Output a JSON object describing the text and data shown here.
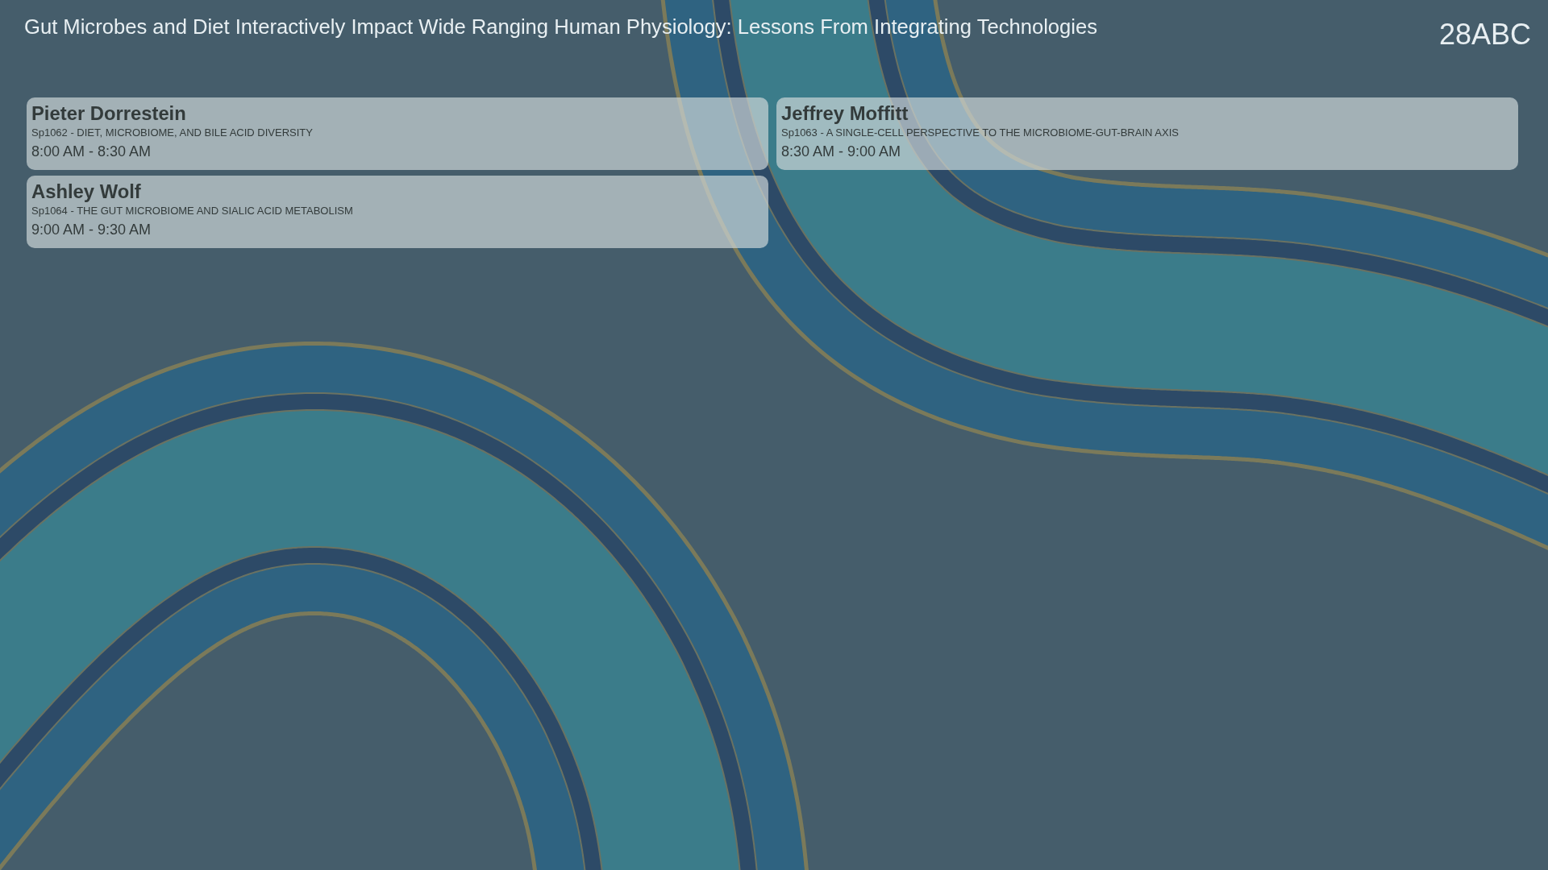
{
  "header": {
    "title": "Gut Microbes and Diet Interactively Impact Wide Ranging Human Physiology: Lessons From Integrating Technologies",
    "room": "28ABC"
  },
  "sessions": [
    {
      "speaker": "Pieter Dorrestein",
      "title": "Sp1062 - DIET, MICROBIOME, AND BILE ACID DIVERSITY",
      "time": "8:00 AM - 8:30 AM"
    },
    {
      "speaker": "Jeffrey Moffitt",
      "title": "Sp1063 - A SINGLE-CELL PERSPECTIVE TO THE MICROBIOME-GUT-BRAIN AXIS",
      "time": "8:30 AM - 9:00 AM"
    },
    {
      "speaker": "Ashley Wolf",
      "title": "Sp1064 - THE GUT MICROBIOME AND SIALIC ACID METABOLISM",
      "time": "9:00 AM - 9:30 AM"
    }
  ]
}
